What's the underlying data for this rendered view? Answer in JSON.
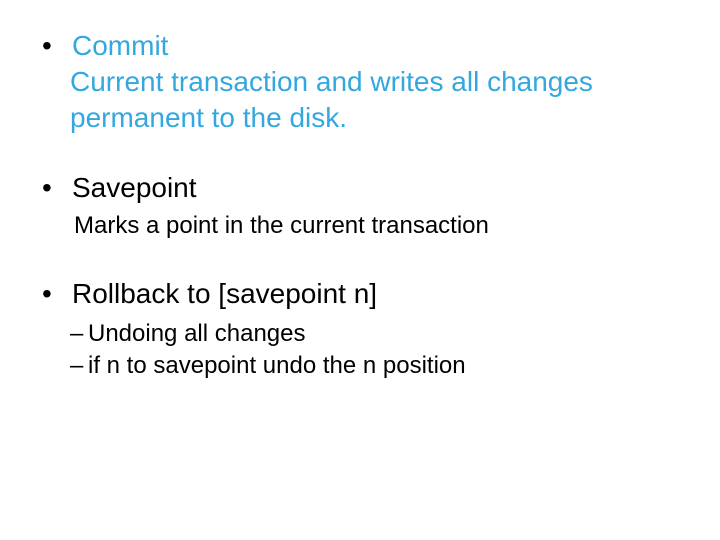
{
  "items": [
    {
      "title": "Commit",
      "title_class": "commit-color",
      "desc": "Current transaction and writes all changes permanent to the disk.",
      "desc_class": "commit-color",
      "desc_size": "bullet-body",
      "subs": []
    },
    {
      "title": "Savepoint",
      "title_class": "black",
      "desc": "Marks a point in the current transaction",
      "desc_class": "black",
      "desc_size": "bullet-body-sm",
      "subs": []
    },
    {
      "title": "Rollback to [savepoint n]",
      "title_class": "black",
      "desc": "",
      "desc_class": "black",
      "desc_size": "bullet-body-sm",
      "subs": [
        "Undoing all changes",
        "if n to savepoint undo the n position"
      ]
    }
  ]
}
